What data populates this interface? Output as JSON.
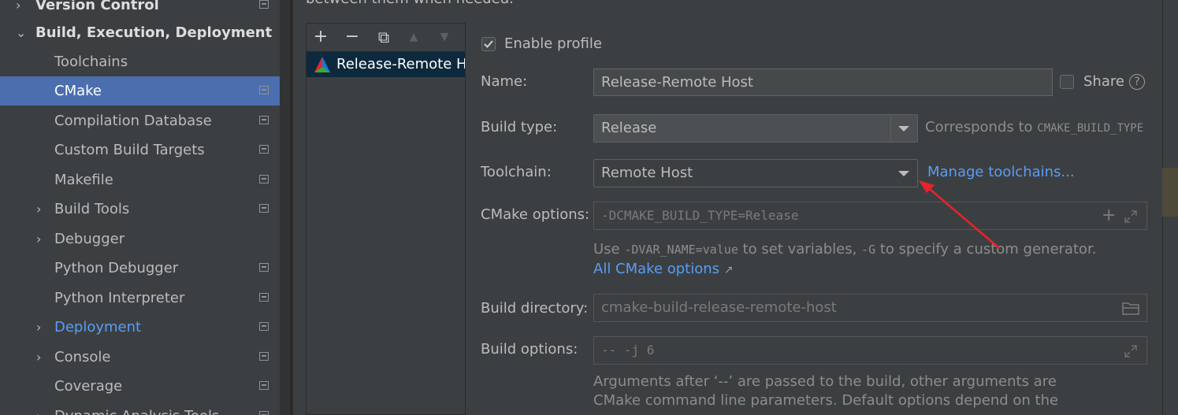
{
  "sidebar": {
    "items": [
      {
        "label": "Version Control",
        "arrow": "›",
        "bold": true
      },
      {
        "label": "Build, Execution, Deployment",
        "arrow": "⌄",
        "bold": true
      },
      {
        "label": "Toolchains"
      },
      {
        "label": "CMake",
        "selected": true
      },
      {
        "label": "Compilation Database"
      },
      {
        "label": "Custom Build Targets"
      },
      {
        "label": "Makefile"
      },
      {
        "label": "Build Tools",
        "arrow": "›"
      },
      {
        "label": "Debugger",
        "arrow": "›"
      },
      {
        "label": "Python Debugger"
      },
      {
        "label": "Python Interpreter"
      },
      {
        "label": "Deployment",
        "arrow": "›",
        "link": true
      },
      {
        "label": "Console",
        "arrow": "›"
      },
      {
        "label": "Coverage"
      },
      {
        "label": "Dynamic Analysis Tools",
        "arrow": "›"
      }
    ]
  },
  "top_text": "between them when needed.",
  "toolbar": {
    "add": "+",
    "remove": "−",
    "copy": "⧉",
    "up": "▲",
    "down": "▼"
  },
  "profiles": {
    "items": [
      {
        "name": "Release-Remote Host"
      }
    ]
  },
  "form": {
    "enable_profile": {
      "label": "Enable profile",
      "checked": true
    },
    "name": {
      "label": "Name:",
      "value": "Release-Remote Host"
    },
    "share": {
      "label": "Share",
      "checked": false,
      "help": "?"
    },
    "build_type": {
      "label": "Build type:",
      "value": "Release",
      "hint_prefix": "Corresponds to ",
      "hint_code": "CMAKE_BUILD_TYPE"
    },
    "toolchain": {
      "label": "Toolchain:",
      "value": "Remote Host",
      "manage_link": "Manage toolchains..."
    },
    "cmake_options": {
      "label": "CMake options:",
      "placeholder": "-DCMAKE_BUILD_TYPE=Release"
    },
    "cmake_hint": {
      "use": "Use ",
      "code1": "-DVAR_NAME=value",
      "mid": " to set variables, ",
      "code2": "-G",
      "end": " to specify a custom generator.",
      "link": "All CMake options",
      "link_arrow": "↗"
    },
    "build_directory": {
      "label": "Build directory:",
      "placeholder": "cmake-build-release-remote-host"
    },
    "build_options": {
      "label": "Build options:",
      "placeholder": "-- -j 6"
    },
    "build_hint_line1": "Arguments after ‘--’ are passed to the build, other arguments are",
    "build_hint_line2": "CMake command line parameters. Default options depend on the"
  },
  "colors": {
    "selected_row": "#4b6eaf",
    "link": "#589df6",
    "annotation_arrow": "#e8232a"
  }
}
